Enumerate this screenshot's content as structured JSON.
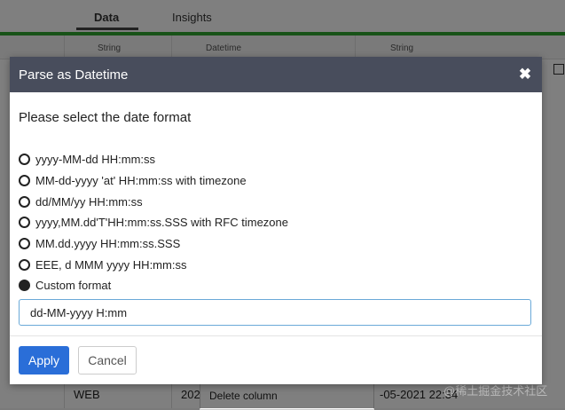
{
  "background": {
    "tabs": [
      {
        "label": "Data"
      },
      {
        "label": "Insights"
      }
    ],
    "columns": [
      {
        "type": "String"
      },
      {
        "type": "Datetime"
      },
      {
        "type": "String"
      }
    ],
    "row": {
      "col1": "WEB",
      "col2": "202",
      "col3": "-05-2021 22:34"
    },
    "context_menu": {
      "item": "Delete column"
    },
    "watermark": "@稀土掘金技术社区"
  },
  "modal": {
    "title": "Parse as Datetime",
    "close_icon": "close-icon",
    "prompt": "Please select the date format",
    "options": [
      {
        "label": "yyyy-MM-dd HH:mm:ss",
        "checked": false
      },
      {
        "label": "MM-dd-yyyy 'at' HH:mm:ss with timezone",
        "checked": false
      },
      {
        "label": "dd/MM/yy HH:mm:ss",
        "checked": false
      },
      {
        "label": "yyyy,MM.dd'T'HH:mm:ss.SSS with RFC timezone",
        "checked": false
      },
      {
        "label": "MM.dd.yyyy HH:mm:ss.SSS",
        "checked": false
      },
      {
        "label": "EEE, d MMM yyyy HH:mm:ss",
        "checked": false
      },
      {
        "label": "Custom format",
        "checked": true
      }
    ],
    "custom_format_value": "dd-MM-yyyy H:mm",
    "apply_label": "Apply",
    "cancel_label": "Cancel"
  },
  "colors": {
    "header_bg": "#484d5c",
    "apply_bg": "#2a6ed8",
    "input_border": "#6aa9d8",
    "green_bar": "#2fa52f"
  }
}
